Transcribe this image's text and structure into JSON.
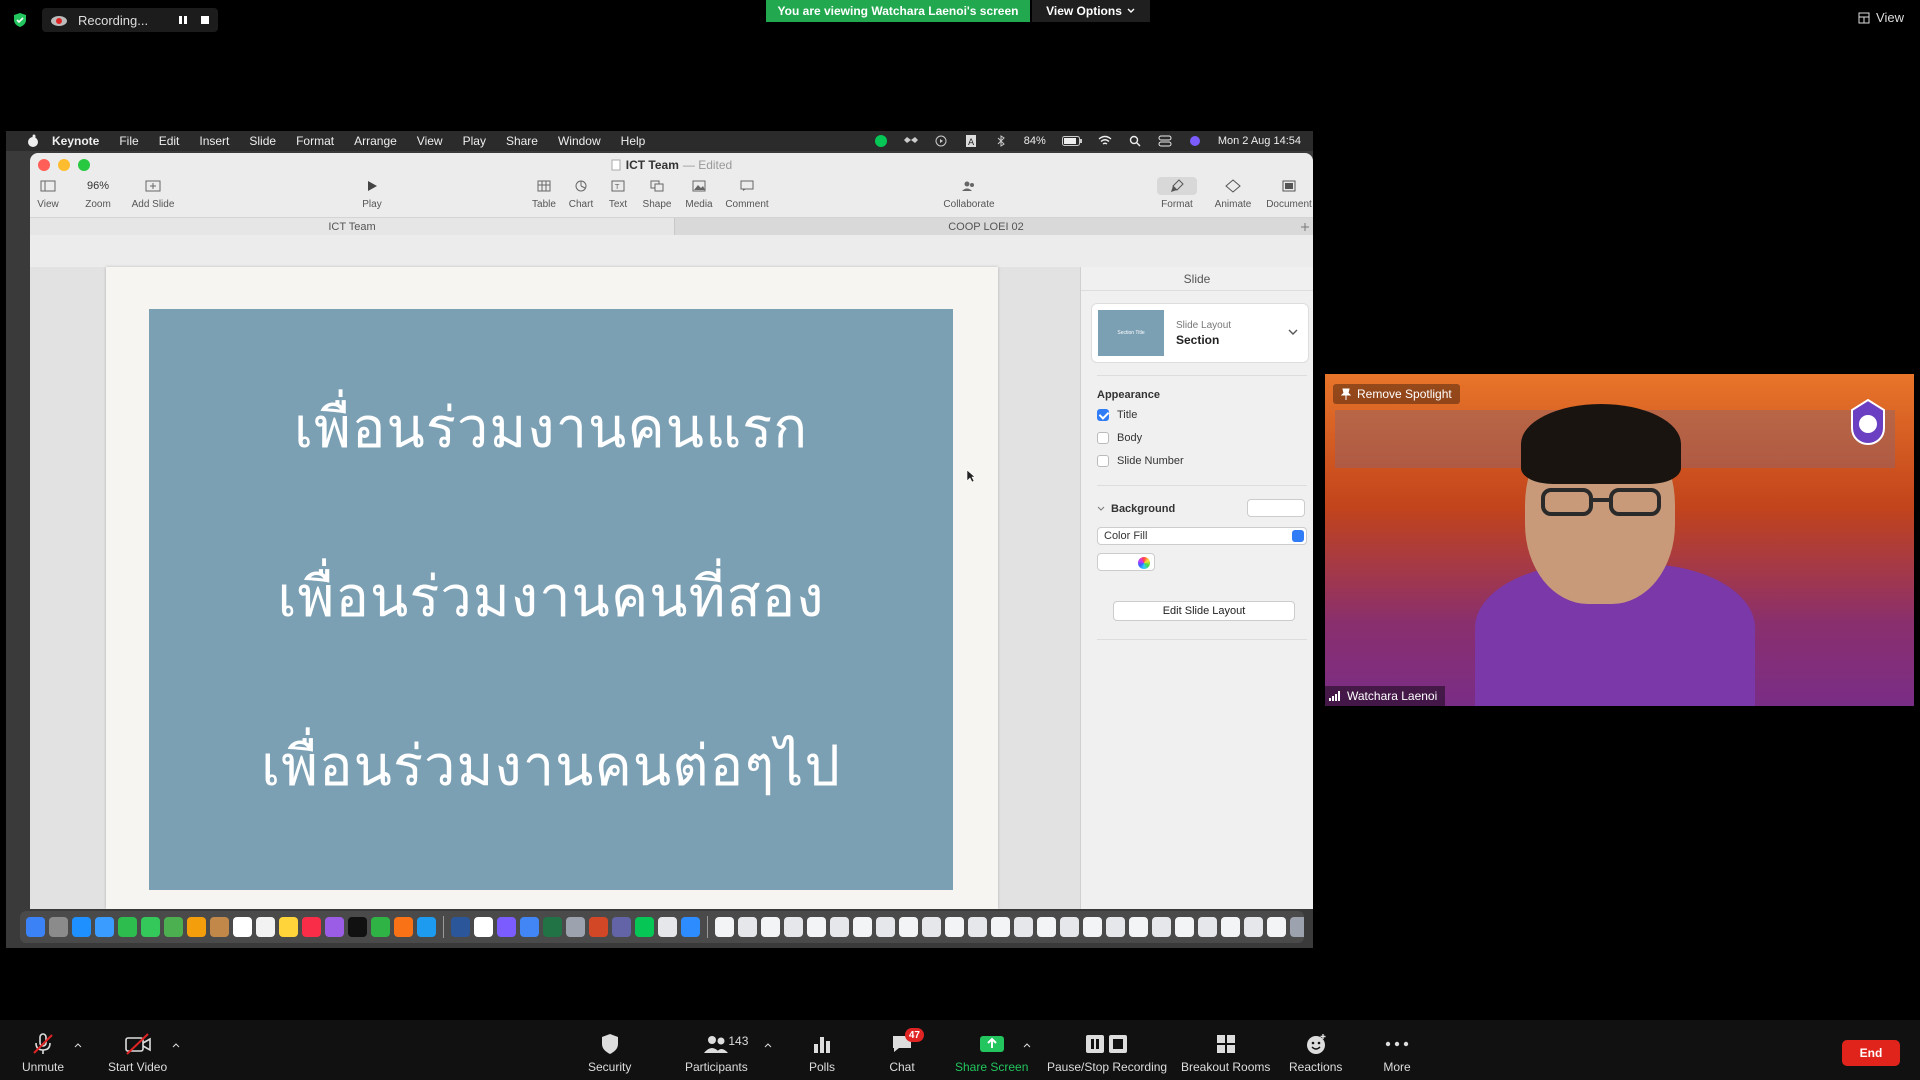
{
  "zoom_top": {
    "recording_label": "Recording...",
    "viewing_banner": "You are viewing Watchara Laenoi's screen",
    "view_options_label": "View Options",
    "view_label": "View"
  },
  "mac_menubar": {
    "app_name": "Keynote",
    "items": [
      "File",
      "Edit",
      "Insert",
      "Slide",
      "Format",
      "Arrange",
      "View",
      "Play",
      "Share",
      "Window",
      "Help"
    ],
    "battery": "84%",
    "clock": "Mon 2 Aug  14:54"
  },
  "keynote": {
    "doc_title": "ICT Team",
    "doc_status": "— Edited",
    "toolbar": {
      "view": "View",
      "zoom_value": "96%",
      "zoom": "Zoom",
      "add_slide": "Add Slide",
      "play": "Play",
      "table": "Table",
      "chart": "Chart",
      "text": "Text",
      "shape": "Shape",
      "media": "Media",
      "comment": "Comment",
      "collaborate": "Collaborate",
      "format": "Format",
      "animate": "Animate",
      "document": "Document"
    },
    "tabs": [
      "ICT Team",
      "COOP LOEI 02"
    ],
    "slide_lines": [
      "เพื่อนร่วมงานคนแรก",
      "เพื่อนร่วมงานคนที่สอง",
      "เพื่อนร่วมงานคนต่อๆไป"
    ],
    "slide_bg_color": "#7b9fb3",
    "inspector": {
      "title": "Slide",
      "layout_label": "Slide Layout",
      "layout_value": "Section",
      "layout_thumb_text": "Section Title",
      "appearance_title": "Appearance",
      "checks": [
        {
          "label": "Title",
          "checked": true
        },
        {
          "label": "Body",
          "checked": false
        },
        {
          "label": "Slide Number",
          "checked": false
        }
      ],
      "background_title": "Background",
      "fill_value": "Color Fill",
      "edit_layout_button": "Edit Slide Layout"
    }
  },
  "speaker": {
    "remove_spotlight": "Remove Spotlight",
    "name": "Watchara Laenoi"
  },
  "zoom_bottom": {
    "unmute": "Unmute",
    "start_video": "Start Video",
    "security": "Security",
    "participants": "Participants",
    "participants_count": "143",
    "polls": "Polls",
    "chat": "Chat",
    "chat_badge": "47",
    "share_screen": "Share Screen",
    "pause_stop_recording": "Pause/Stop Recording",
    "breakout_rooms": "Breakout Rooms",
    "reactions": "Reactions",
    "more": "More",
    "end": "End"
  }
}
